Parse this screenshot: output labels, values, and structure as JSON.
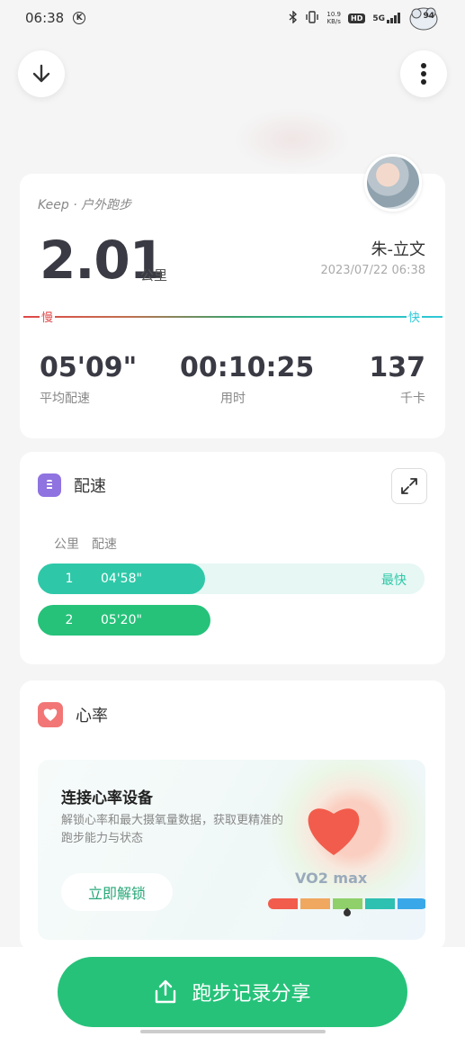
{
  "status_bar": {
    "time": "06:38",
    "k_icon": "K",
    "net_speed_value": "10.9",
    "net_speed_unit": "KB/s",
    "hd_badge": "HD",
    "network": "5G",
    "battery": "94",
    "icons": [
      "bluetooth-icon",
      "vibrate-icon",
      "signal-icon"
    ]
  },
  "summary": {
    "brand": "Keep · 户外跑步",
    "distance": "2.01",
    "distance_unit": "公里",
    "user_name": "朱-立文",
    "date": "2023/07/22 06:38",
    "slow_label": "慢",
    "fast_label": "快",
    "stats": [
      {
        "value": "05'09\"",
        "label": "平均配速"
      },
      {
        "value": "00:10:25",
        "label": "用时"
      },
      {
        "value": "137",
        "label": "千卡"
      }
    ]
  },
  "pace": {
    "title": "配速",
    "col_km": "公里",
    "col_pace": "配速",
    "fastest_label": "最快",
    "rows": [
      {
        "km": "1",
        "pace": "04'58\"",
        "relative": 1.0
      },
      {
        "km": "2",
        "pace": "05'20\"",
        "relative": 0.93
      }
    ]
  },
  "heart_rate": {
    "title": "心率",
    "unlock_title": "连接心率设备",
    "unlock_desc": "解锁心率和最大摄氧量数据，获取更精准的跑步能力与状态",
    "unlock_button": "立即解锁",
    "vo2_label": "VO2 max",
    "scale_colors": [
      "#f25c4c",
      "#f0a860",
      "#8fd06a",
      "#2ec0b0",
      "#3aa8e8"
    ]
  },
  "share": {
    "label": "跑步记录分享"
  },
  "colors": {
    "primary_green": "#26c27a",
    "pace_teal": "#2ec8a8",
    "slow_red": "#e04848",
    "fast_cyan": "#2ec8d8"
  }
}
